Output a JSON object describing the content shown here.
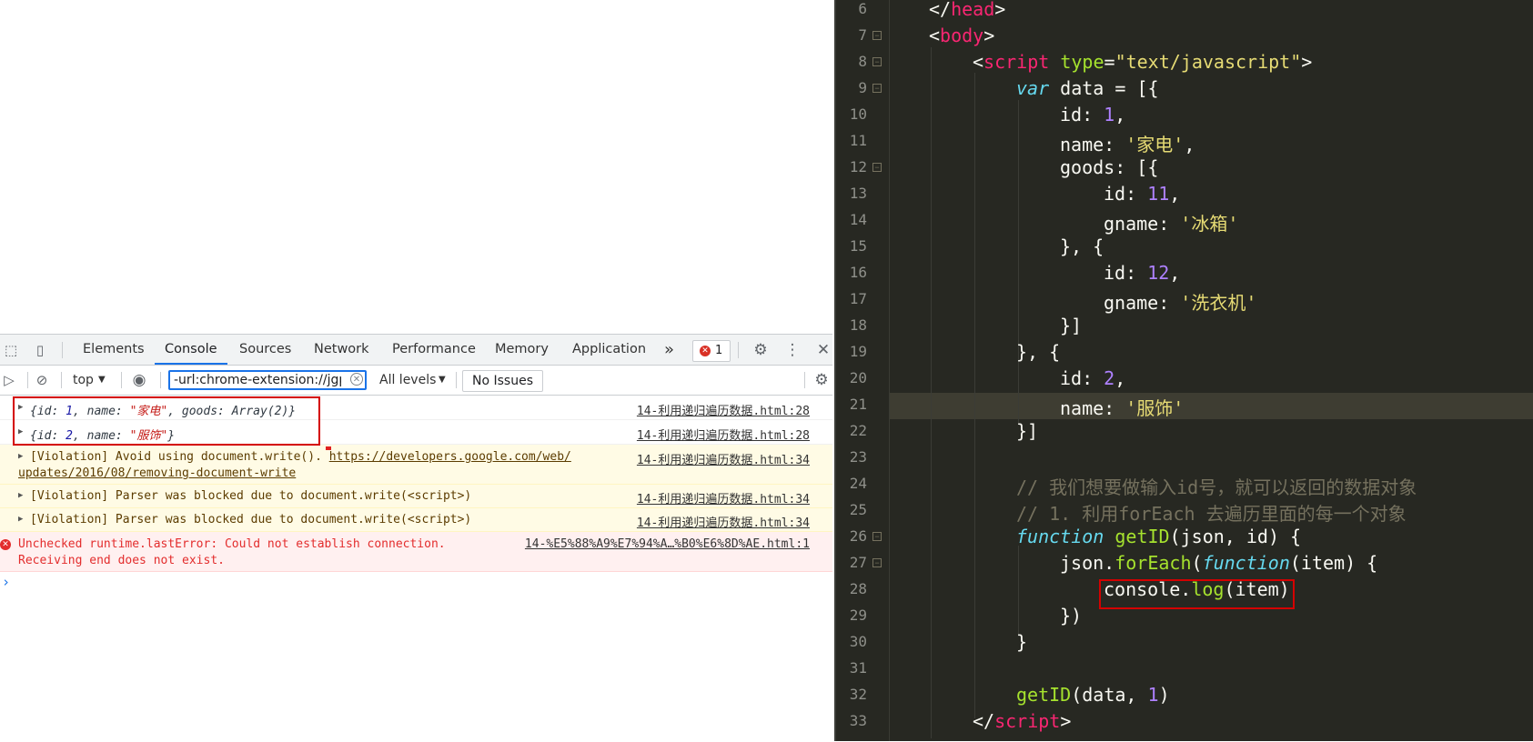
{
  "devtools": {
    "tabs": [
      "Elements",
      "Console",
      "Sources",
      "Network",
      "Performance",
      "Memory",
      "Application"
    ],
    "more_tabs": "»",
    "error_count": "1",
    "context": "top",
    "filter_value": "-url:chrome-extension://jgphn",
    "levels": "All levels",
    "no_issues": "No Issues"
  },
  "console": {
    "log1": {
      "prefix": "{id: ",
      "id": "1",
      "mid1": ", name: ",
      "name": "\"家电\"",
      "mid2": ", goods: Array(2)}",
      "src": "14-利用递归遍历数据.html:28"
    },
    "log2": {
      "prefix": "{id: ",
      "id": "2",
      "mid1": ", name: ",
      "name": "\"服饰\"",
      "suffix": "}",
      "src": "14-利用递归遍历数据.html:28"
    },
    "warn1": {
      "line1": "[Violation] Avoid using document.write(). ",
      "link1": "https://developers.google.com/web/",
      "link2": "updates/2016/08/removing-document-write",
      "src": "14-利用递归遍历数据.html:34"
    },
    "warn2": {
      "text": "[Violation] Parser was blocked due to document.write(<script>)",
      "src": "14-利用递归遍历数据.html:34"
    },
    "warn3": {
      "text": "[Violation] Parser was blocked due to document.write(<script>)",
      "src": "14-利用递归遍历数据.html:34"
    },
    "error1": {
      "line1": "Unchecked runtime.lastError: Could not establish connection.",
      "line2": "Receiving end does not exist.",
      "src": "14-%E5%88%A9%E7%94%A…%B0%E6%8D%AE.html:1"
    },
    "prompt": "›"
  },
  "editor": {
    "line_numbers": [
      "6",
      "7",
      "8",
      "9",
      "10",
      "11",
      "12",
      "13",
      "14",
      "15",
      "16",
      "17",
      "18",
      "19",
      "20",
      "21",
      "22",
      "23",
      "24",
      "25",
      "26",
      "27",
      "28",
      "29",
      "30",
      "31",
      "32",
      "33"
    ],
    "l6": {
      "a": "</",
      "b": "head",
      "c": ">"
    },
    "l7": {
      "a": "<",
      "b": "body",
      "c": ">"
    },
    "l8": {
      "a": "<",
      "b": "script",
      "c": " ",
      "d": "type",
      "e": "=",
      "f": "\"text/javascript\"",
      "g": ">"
    },
    "l9": {
      "kw": "var",
      "rest": " data = [{"
    },
    "l10": {
      "a": "id: ",
      "n": "1",
      "b": ","
    },
    "l11": {
      "a": "name: ",
      "s": "'家电'",
      "b": ","
    },
    "l12": {
      "a": "goods: [{"
    },
    "l13": {
      "a": "id: ",
      "n": "11",
      "b": ","
    },
    "l14": {
      "a": "gname: ",
      "s": "'冰箱'"
    },
    "l15": {
      "a": "}, {"
    },
    "l16": {
      "a": "id: ",
      "n": "12",
      "b": ","
    },
    "l17": {
      "a": "gname: ",
      "s": "'洗衣机'"
    },
    "l18": {
      "a": "}]"
    },
    "l19": {
      "a": "}, {"
    },
    "l20": {
      "a": "id: ",
      "n": "2",
      "b": ","
    },
    "l21": {
      "a": "name: ",
      "s": "'服饰'"
    },
    "l22": {
      "a": "}]"
    },
    "l24": "// 我们想要做输入id号，就可以返回的数据对象",
    "l25": "// 1. 利用forEach 去遍历里面的每一个对象",
    "l26": {
      "kw": "function",
      "sp": " ",
      "fn": "getID",
      "rest": "(json, id) {"
    },
    "l27": {
      "a": "json.",
      "fn": "forEach",
      "b": "(",
      "kw": "function",
      "c": "(item) {"
    },
    "l28": {
      "a": "console.",
      "fn": "log",
      "b": "(item)"
    },
    "l29": {
      "a": "})"
    },
    "l30": {
      "a": "}"
    },
    "l32": {
      "fn": "getID",
      "a": "(data, ",
      "n": "1",
      "b": ")"
    },
    "l33": {
      "a": "</",
      "b": "script",
      "c": ">"
    }
  },
  "colors": {
    "editor_bg": "#272822",
    "tag": "#f92672",
    "string": "#e6db74",
    "keyword": "#66d9ef",
    "number": "#ae81ff",
    "function": "#a6e22e",
    "comment": "#75715e",
    "highlight_box": "#d40000",
    "devtools_accent": "#1a73e8"
  }
}
